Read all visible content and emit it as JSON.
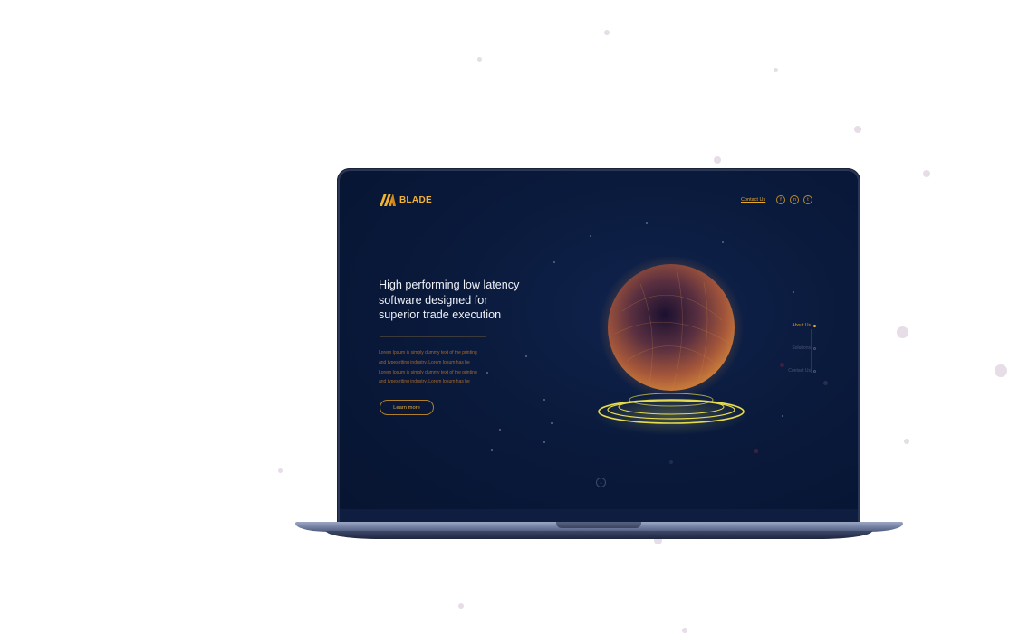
{
  "brand": {
    "name": "BLADE",
    "accent_color": "#f2b233"
  },
  "header": {
    "contact_label": "Contact Us",
    "social": [
      {
        "icon": "facebook-icon",
        "glyph": "f"
      },
      {
        "icon": "linkedin-icon",
        "glyph": "in"
      },
      {
        "icon": "twitter-icon",
        "glyph": "t"
      }
    ]
  },
  "hero": {
    "headline_lines": [
      "High performing low latency",
      "software designed for",
      "superior trade execution"
    ],
    "paragraph_lines": [
      "Lorem Ipsum is simply dummy text of the printing",
      "and typesetting industry. Lorem Ipsum has be",
      "Lorem Ipsum is simply dummy text of the printing",
      "and typesetting industry. Lorem Ipsum has be"
    ],
    "cta_label": "Learn more"
  },
  "side_nav": {
    "items": [
      {
        "label": "About Us",
        "active": true
      },
      {
        "label": "Solutions",
        "active": false
      },
      {
        "label": "Contact Us",
        "active": false
      }
    ]
  },
  "scroll": {
    "glyph": "⌄"
  }
}
